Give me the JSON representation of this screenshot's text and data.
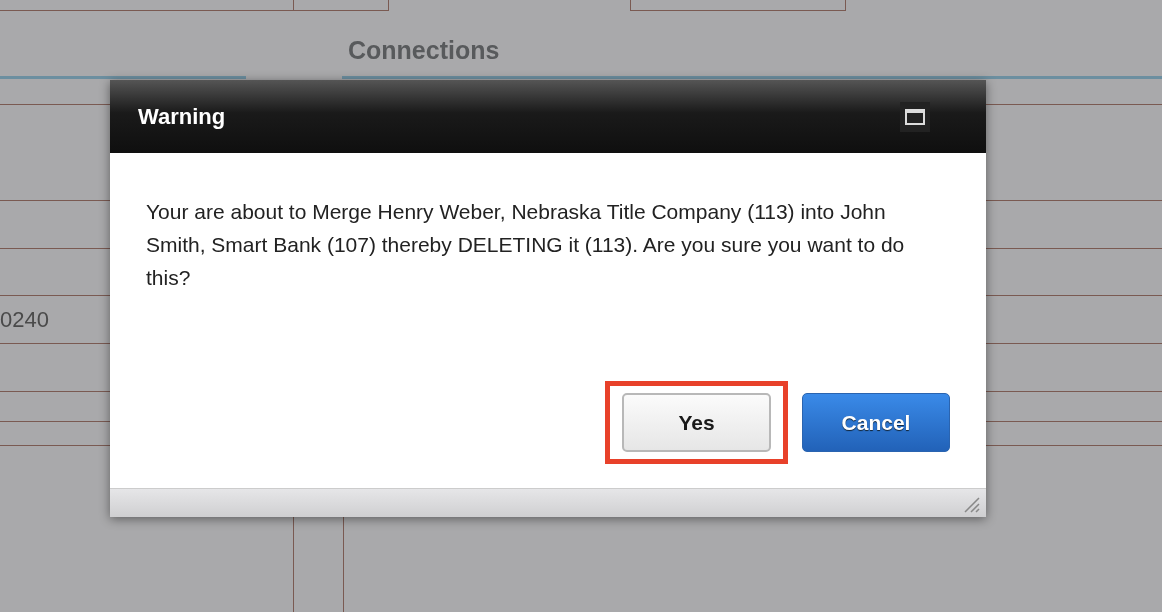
{
  "page": {
    "heading": "Connections",
    "cell_text": "0240"
  },
  "dialog": {
    "title": "Warning",
    "message": "Your are about to Merge Henry Weber, Nebraska Title Company (113) into John Smith, Smart Bank (107) thereby DELETING it (113). Are you sure you want to do this?",
    "buttons": [
      {
        "label": "Yes",
        "kind": "default",
        "highlighted": true
      },
      {
        "label": "Cancel",
        "kind": "primary",
        "highlighted": false
      }
    ]
  }
}
